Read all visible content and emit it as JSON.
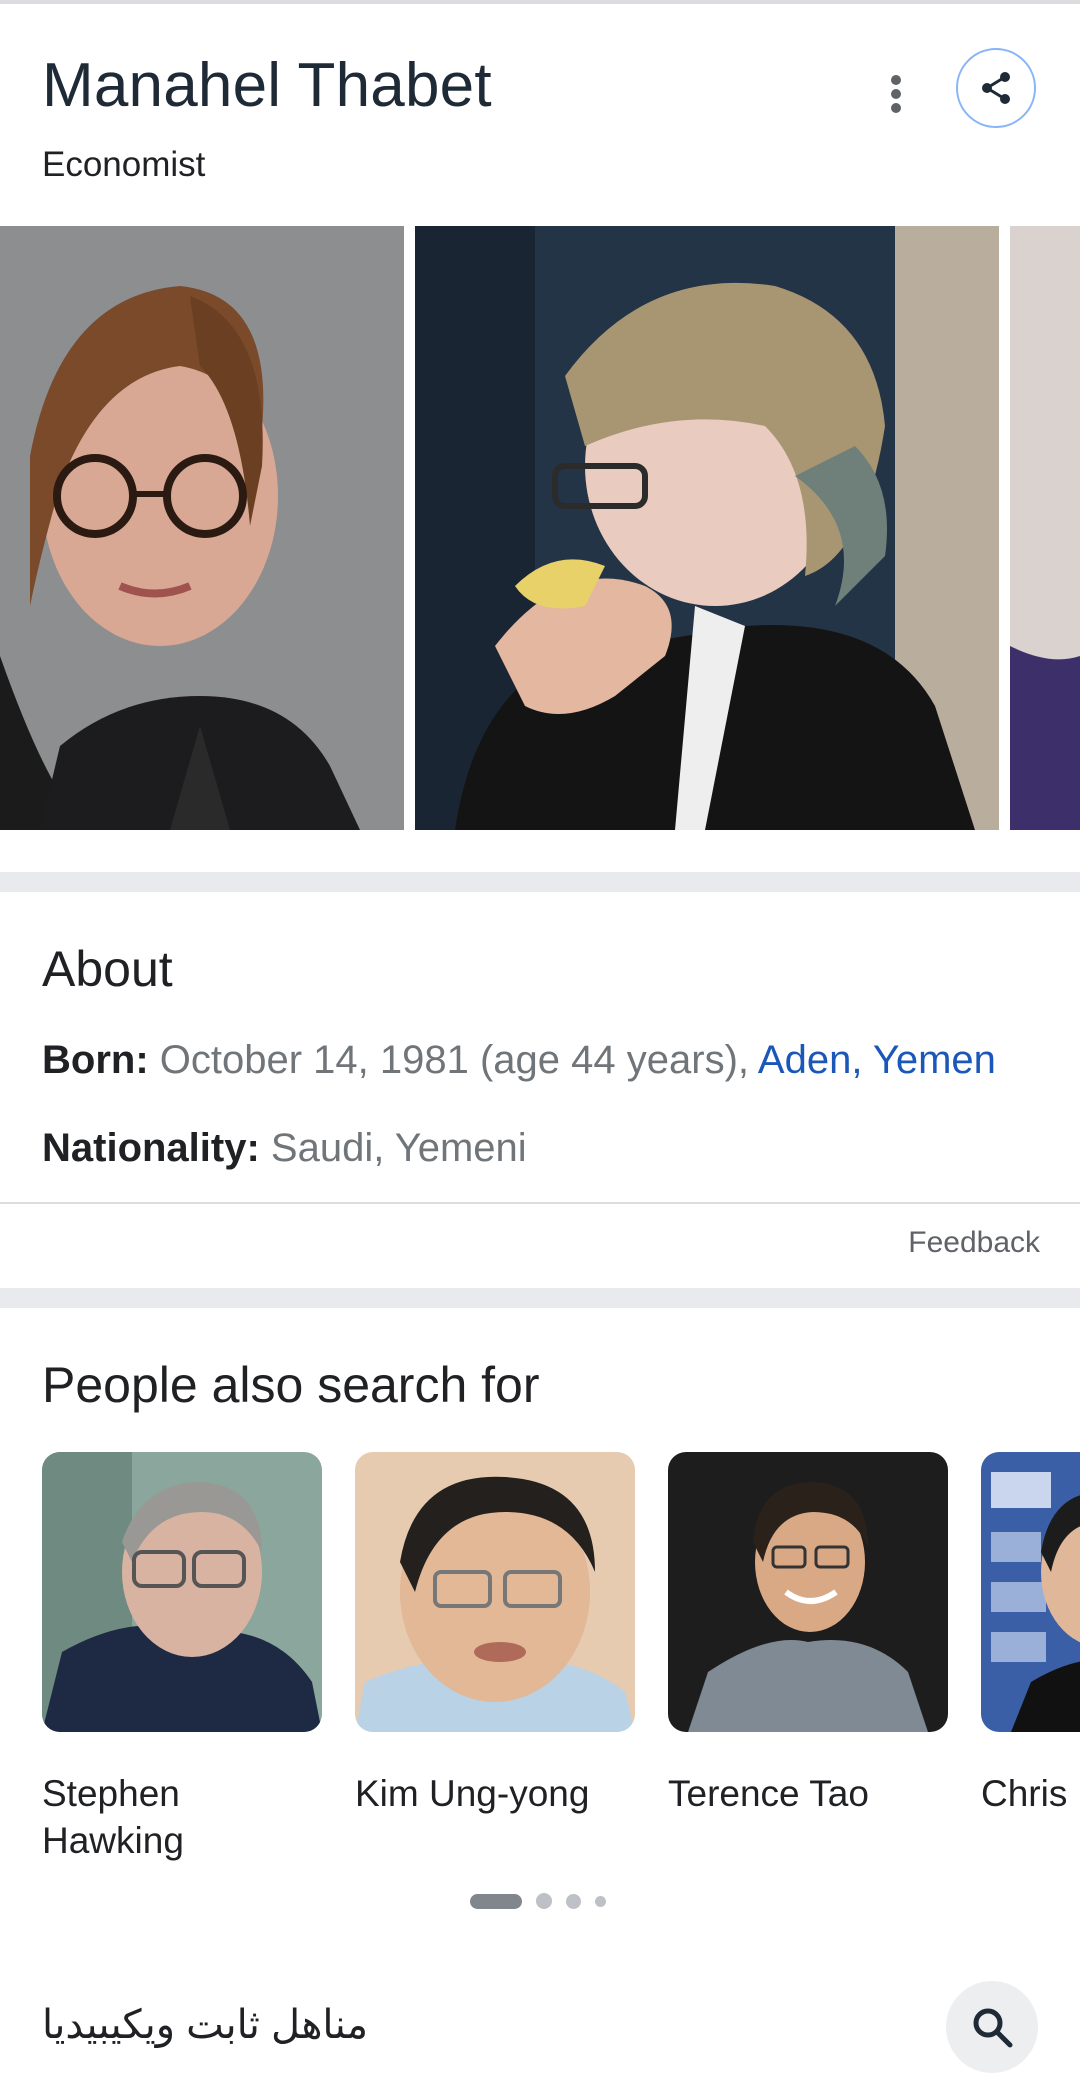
{
  "header": {
    "title": "Manahel Thabet",
    "subtitle": "Economist"
  },
  "about": {
    "heading": "About",
    "born_label": "Born:",
    "born_value": "October 14, 1981 (age 44 years),",
    "born_place": "Aden, Yemen",
    "nationality_label": "Nationality:",
    "nationality_value": "Saudi, Yemeni",
    "feedback": "Feedback"
  },
  "people": {
    "heading": "People also search for",
    "items": [
      {
        "name": "Stephen Hawking"
      },
      {
        "name": "Kim Ung-yong"
      },
      {
        "name": "Terence Tao"
      },
      {
        "name": "Chris"
      }
    ]
  },
  "related_search": {
    "text": "مناهل ثابت ويكيبيديا"
  },
  "icons": {
    "more": "more-vert-icon",
    "share": "share-icon",
    "search": "search-icon"
  },
  "colors": {
    "link": "#1a57b8",
    "share_border": "#8ab4f8"
  }
}
